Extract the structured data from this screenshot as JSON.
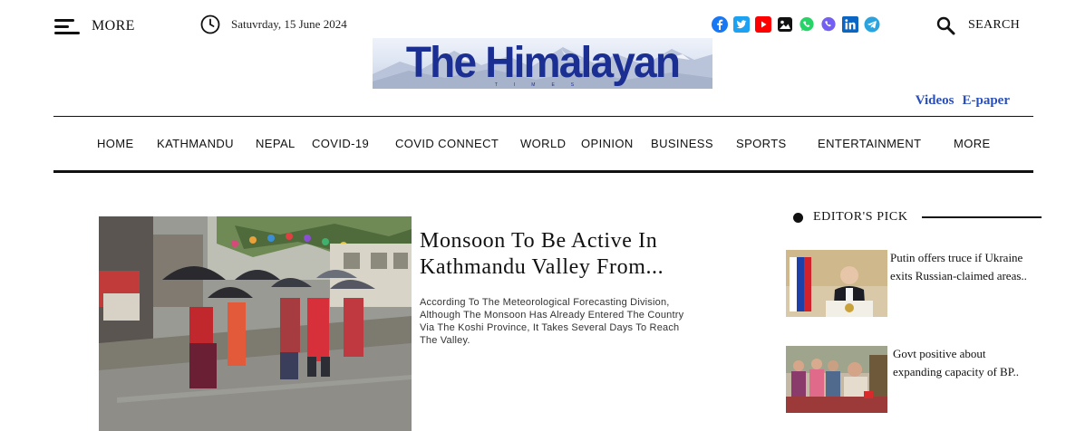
{
  "header": {
    "menu_label": "MORE",
    "date": "Satuvrday, 15 June 2024",
    "search_label": "SEARCH",
    "social": [
      {
        "icon": "facebook-icon",
        "color": "#1877f2"
      },
      {
        "icon": "twitter-icon",
        "color": "#1da1f2"
      },
      {
        "icon": "youtube-icon",
        "color": "#ff0000"
      },
      {
        "icon": "flickr-icon",
        "color": "#111111"
      },
      {
        "icon": "whatsapp-icon",
        "color": "#25d366"
      },
      {
        "icon": "viber-icon",
        "color": "#7360f2"
      },
      {
        "icon": "linkedin-icon",
        "color": "#0a66c2"
      },
      {
        "icon": "telegram-icon",
        "color": "#2aa3df"
      }
    ]
  },
  "logo": {
    "title": "The Himalayan",
    "subtitle": "TIMES",
    "color": "#1b2f93"
  },
  "top_links": {
    "videos": "Videos",
    "epaper": "E-paper",
    "color": "#2a4fb8"
  },
  "nav": [
    "HOME",
    "KATHMANDU",
    "NEPAL",
    "COVID-19",
    "COVID CONNECT",
    "WORLD",
    "OPINION",
    "BUSINESS",
    "SPORTS",
    "ENTERTAINMENT",
    "MORE"
  ],
  "lead": {
    "title": "Monsoon To Be Active In Kathmandu Valley From...",
    "summary": "According To The Meteorological Forecasting Division, Although The Monsoon Has Already Entered The Country Via The Koshi Province, It Takes Several Days To Reach The Valley."
  },
  "editors_pick": {
    "heading": "EDITOR'S PICK",
    "items": [
      {
        "title_line1": "Putin offers truce if Ukraine",
        "title_line2": "exits Russian-claimed areas.."
      },
      {
        "title_line1": "Govt positive about",
        "title_line2": "expanding capacity of BP.."
      }
    ]
  }
}
